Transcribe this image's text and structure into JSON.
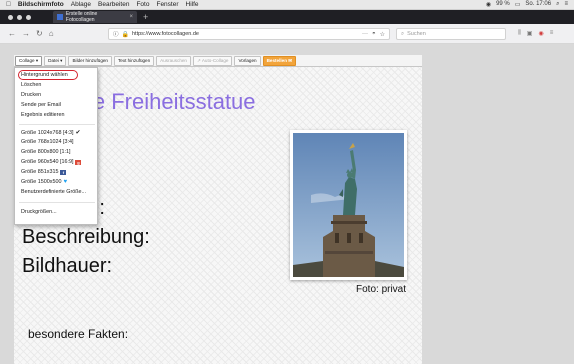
{
  "menubar": {
    "apple": "",
    "app_name": "Bildschirmfoto",
    "items": [
      "Ablage",
      "Bearbeiten",
      "Foto",
      "Fenster",
      "Hilfe"
    ],
    "status": {
      "battery": "99 %",
      "time": "So. 17:06"
    }
  },
  "browser": {
    "tab_title": "Erstelle online Fotocollagen",
    "url": "https://www.fotocollagen.de",
    "search_placeholder": "Suchen"
  },
  "toolbar": {
    "buttons": [
      {
        "label": "Collage ▾",
        "state": "active"
      },
      {
        "label": "Datei ▾",
        "state": "normal"
      },
      {
        "label": "Bilder hinzufügen",
        "state": "normal"
      },
      {
        "label": "Text hinzufügen",
        "state": "normal"
      },
      {
        "label": "Ausrauschen",
        "state": "dim"
      },
      {
        "label": "↗ Auto-Collage",
        "state": "dim"
      },
      {
        "label": "Vorlagen",
        "state": "normal"
      },
      {
        "label": "Bestellen ✉",
        "state": "orange"
      }
    ]
  },
  "dropdown": {
    "items": [
      {
        "label": "Hintergrund wählen",
        "highlighted": true
      },
      {
        "label": "Löschen"
      },
      {
        "label": "Drucken"
      },
      {
        "label": "Sende per Email"
      },
      {
        "label": "Ergebnis editieren"
      },
      {
        "label": "Größe 1024x768 [4:3]",
        "checked": true
      },
      {
        "label": "Größe 768x1024 [3:4]"
      },
      {
        "label": "Größe 800x800 [1:1]"
      },
      {
        "label": "Größe 960x540 [16:9]",
        "icon": "google-plus-icon"
      },
      {
        "label": "Größe 851x315",
        "icon": "facebook-icon"
      },
      {
        "label": "Größe 1500x500",
        "icon": "twitter-icon"
      },
      {
        "label": "Benutzerdefinierte Größe..."
      },
      {
        "label": "Druckgrößen..."
      }
    ]
  },
  "collage": {
    "title": "ie Freiheitsstatue",
    "labels": [
      "t:",
      "ung:",
      "Beschreibung:",
      "Bildhauer:"
    ],
    "facts_label": "besondere Fakten:",
    "photo_caption": "Foto: privat"
  },
  "colors": {
    "title": "#8a6ee0",
    "highlight_ring": "#d4232e",
    "order_button": "#f2a43b",
    "tab_bar": "#1f1f24"
  }
}
